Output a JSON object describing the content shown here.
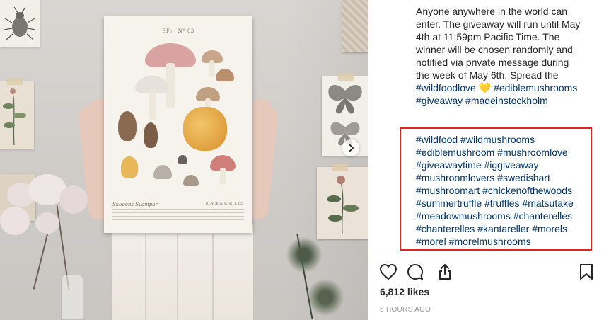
{
  "post": {
    "caption_lines": [
      "Anyone anywhere in the world can",
      "enter. The giveaway will run until May",
      "4th at 11:59pm Pacific Time. The",
      "winner will be chosen randomly and",
      "notified via private message during",
      "the week of May 6th. Spread the"
    ],
    "caption_tags_line1": {
      "tag1": "#wildfoodlove",
      "emoji": "💛",
      "tag2": "#ediblemushrooms"
    },
    "caption_tags_line2": {
      "tag1": "#giveaway",
      "tag2": "#madeinstockholm"
    },
    "hashtag_lines": [
      "#wildfood #wildmushrooms",
      "#ediblemushroom #mushroomlove",
      "#giveawaytime #iggiveaway",
      "#mushroomlovers #swedishart",
      "#mushroomart #chickenofthewoods",
      "#summertruffle #truffles #matsutake",
      "#meadowmushrooms #chanterelles",
      "#chanterelles #kantareller #morels",
      "#morel #morelmushrooms"
    ],
    "likes": "6,812 likes",
    "timestamp": "6 HOURS AGO"
  },
  "poster": {
    "header": "BF₀ · Nº 03",
    "foot_title": "Skogens Svampar",
    "foot_note": "BLACK & WHITE 05"
  },
  "icons": {
    "like": "heart-outline-icon",
    "comment": "speech-bubble-icon",
    "share": "share-upload-icon",
    "save": "bookmark-icon",
    "next": "chevron-right-icon"
  },
  "colors": {
    "text": "#262626",
    "hashtag": "#003569",
    "highlight": "#e0261b",
    "muted": "#999999"
  }
}
